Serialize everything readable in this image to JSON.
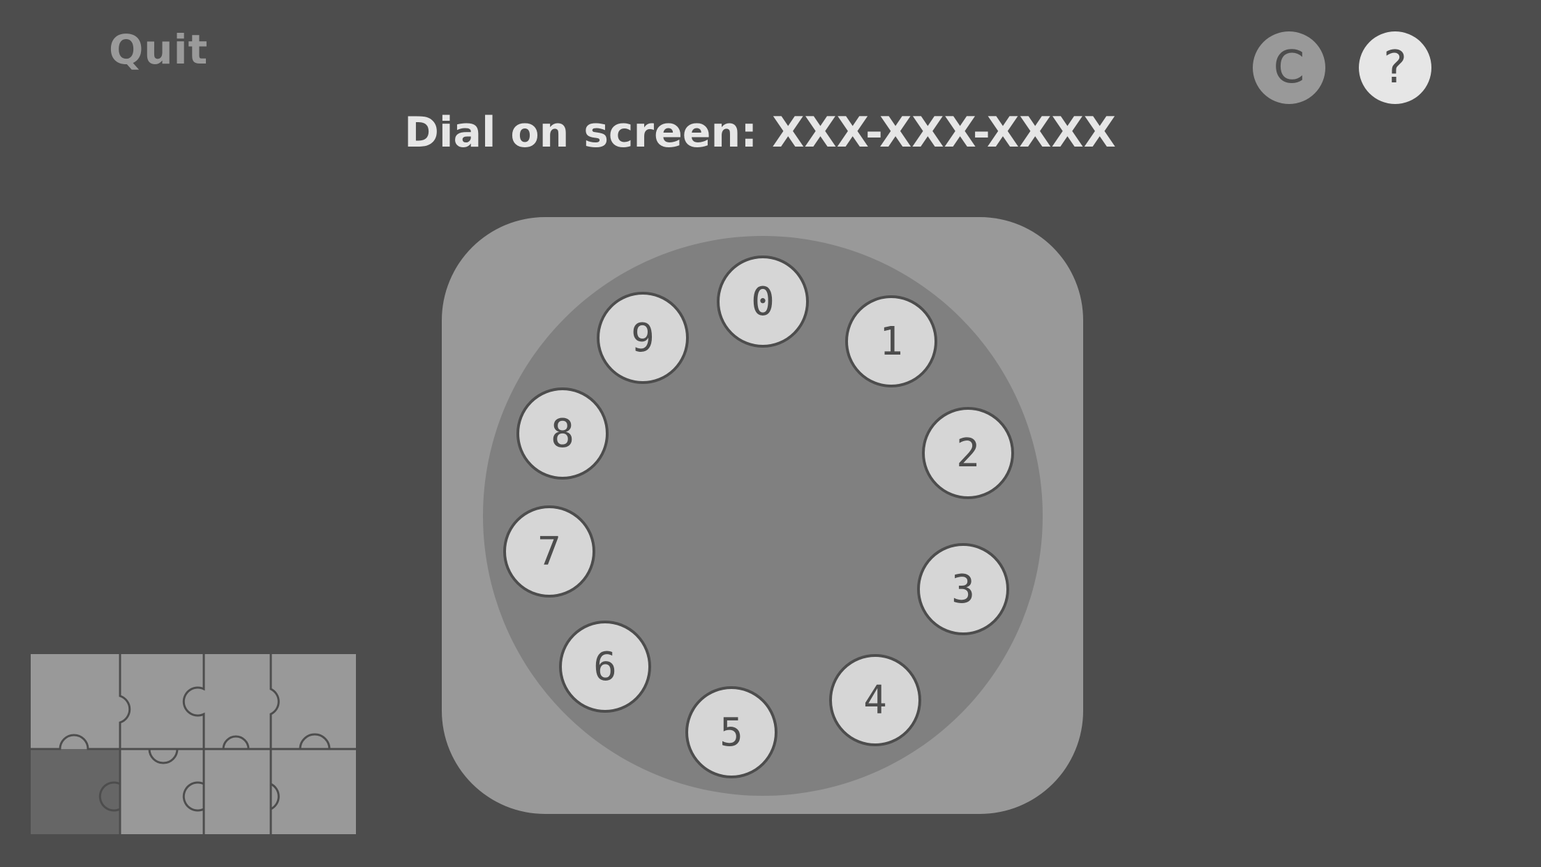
{
  "header": {
    "quit_label": "Quit",
    "clear_label": "C",
    "help_label": "?",
    "title": "Dial on screen: XXX-XXX-XXXX"
  },
  "dial": {
    "digits": [
      "0",
      "1",
      "2",
      "3",
      "4",
      "5",
      "6",
      "7",
      "8",
      "9"
    ]
  },
  "puzzle": {
    "rows": 2,
    "cols": 4,
    "completed_pieces": 1
  },
  "colors": {
    "background": "#4d4d4d",
    "panel": "#999999",
    "disc": "#808080",
    "digit_button": "#d6d6d6",
    "title_text": "#e6e6e6"
  }
}
